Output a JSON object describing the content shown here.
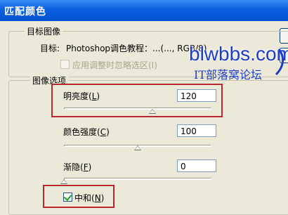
{
  "window": {
    "title": "匹配颜色"
  },
  "target_group": {
    "label": "目标图像",
    "target_prefix": "目标:",
    "target_value": "Photoshop调色教程：...(..., RGB/8)",
    "ignore_selection_label": "应用调整时忽略选区(I)"
  },
  "image_options": {
    "label": "图像选项",
    "luminance": {
      "label_prefix": "明亮度(",
      "hotkey": "L",
      "label_suffix": ")",
      "value": "120",
      "slider_fraction": 0.6
    },
    "color_intensity": {
      "label_prefix": "颜色强度(",
      "hotkey": "C",
      "label_suffix": ")",
      "value": "100",
      "slider_fraction": 0.5
    },
    "fade": {
      "label_prefix": "渐隐(",
      "hotkey": "F",
      "label_suffix": ")",
      "value": "0",
      "slider_fraction": 0.0
    },
    "neutralize": {
      "label_prefix": "中和(",
      "hotkey": "N",
      "label_suffix": ")",
      "checked": true
    }
  },
  "watermark": {
    "logo": "blwbbs.com",
    "subtitle": "IT部落窝论坛"
  },
  "colors": {
    "titlebar": "#0a5fe0",
    "highlight": "#b9272f",
    "watermark": "#1e3ec8",
    "dialog_bg": "#ece9d8"
  }
}
